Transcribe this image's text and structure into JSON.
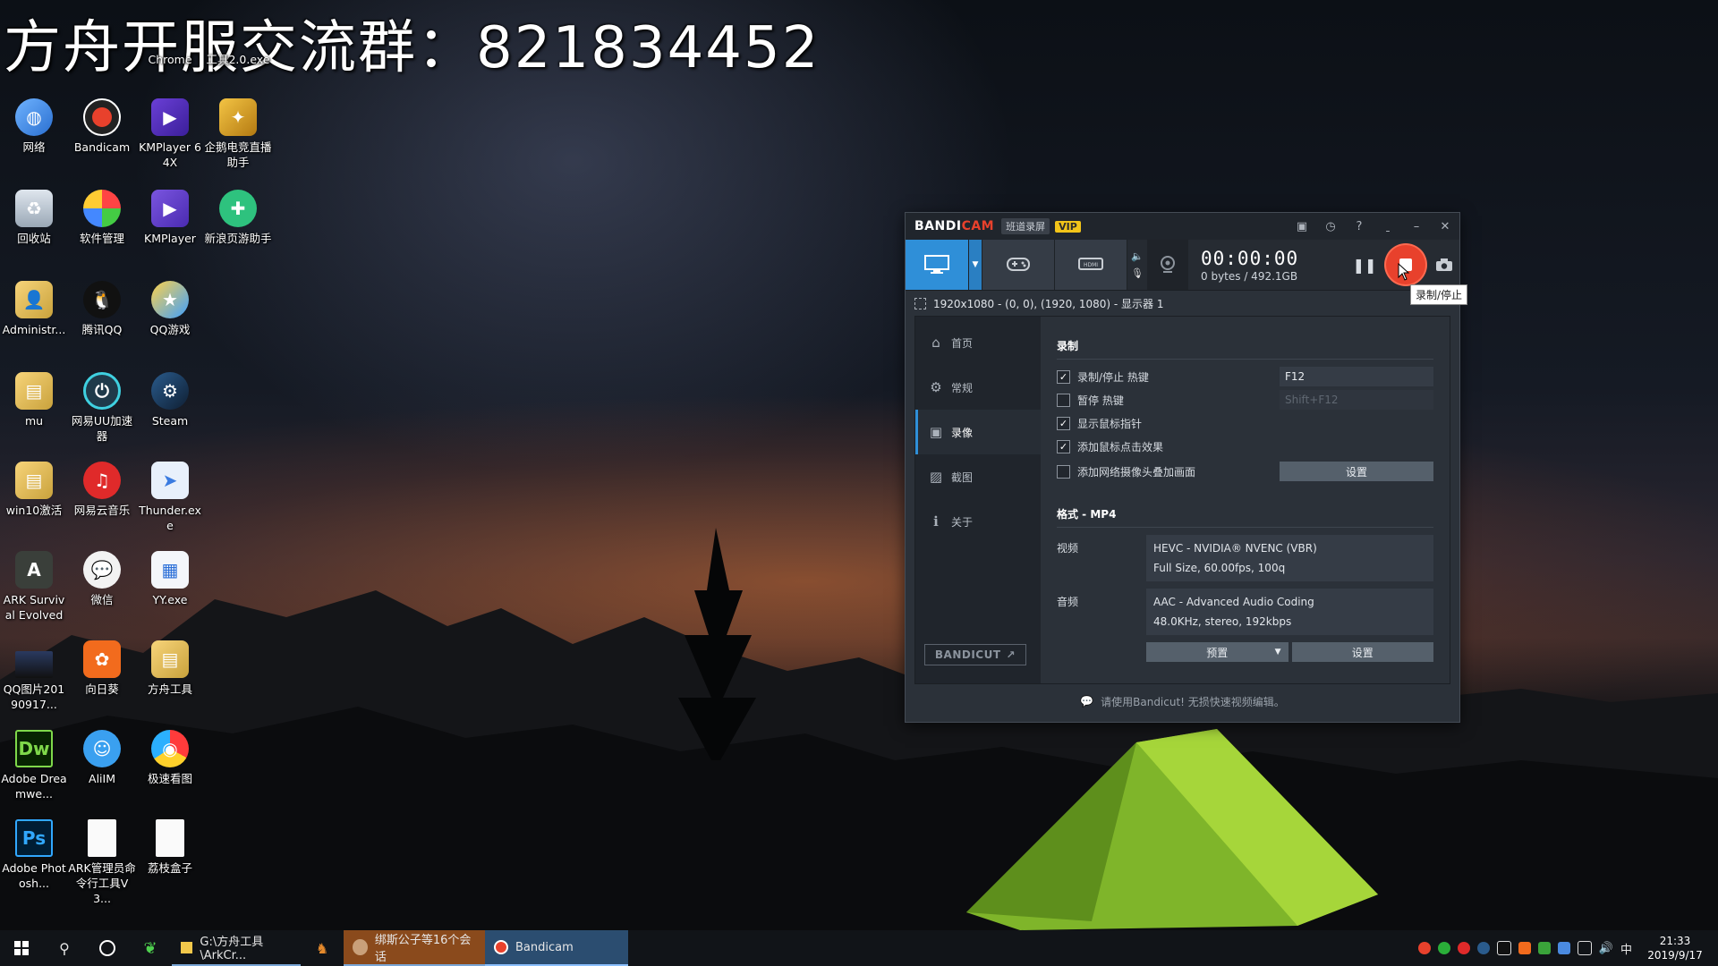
{
  "overlay": {
    "title": "方舟开服交流群：821834452"
  },
  "desktop": {
    "top_partial": [
      "Chrome",
      "工具2.0.exe"
    ],
    "icons": [
      {
        "label": "网络"
      },
      {
        "label": "Bandicam"
      },
      {
        "label": "KMPlayer 64X"
      },
      {
        "label": "企鹅电竞直播助手"
      },
      {
        "label": "回收站"
      },
      {
        "label": "软件管理"
      },
      {
        "label": "KMPlayer"
      },
      {
        "label": "新浪页游助手"
      },
      {
        "label": "Administr..."
      },
      {
        "label": "腾讯QQ"
      },
      {
        "label": "QQ游戏"
      },
      {
        "label": "mu"
      },
      {
        "label": "网易UU加速器"
      },
      {
        "label": "Steam"
      },
      {
        "label": "win10激活"
      },
      {
        "label": "网易云音乐"
      },
      {
        "label": "Thunder.exe"
      },
      {
        "label": "ARK Survival Evolved"
      },
      {
        "label": "微信"
      },
      {
        "label": "YY.exe"
      },
      {
        "label": "QQ图片20190917..."
      },
      {
        "label": "向日葵"
      },
      {
        "label": "方舟工具"
      },
      {
        "label": "Adobe Dreamwe..."
      },
      {
        "label": "AliIM"
      },
      {
        "label": "极速看图"
      },
      {
        "label": "Adobe Photosh..."
      },
      {
        "label": "ARK管理员命令行工具V3..."
      },
      {
        "label": "荔枝盒子"
      }
    ]
  },
  "bandicam": {
    "logo_a": "BANDI",
    "logo_b": "CAM",
    "tag": "班道录屏",
    "vip": "VIP",
    "timer": "00:00:00",
    "size": "0 bytes / 492.1GB",
    "tooltip": "录制/停止",
    "target": "1920x1080 - (0, 0), (1920, 1080) - 显示器 1",
    "sidebar": [
      {
        "label": "首页",
        "icon": "home-icon"
      },
      {
        "label": "常规",
        "icon": "gear-icon"
      },
      {
        "label": "录像",
        "icon": "video-icon"
      },
      {
        "label": "截图",
        "icon": "image-icon"
      },
      {
        "label": "关于",
        "icon": "info-icon"
      }
    ],
    "bandicut_label": "BANDICUT",
    "record_section": "录制",
    "options": [
      {
        "label": "录制/停止 热键",
        "checked": true,
        "value": "F12"
      },
      {
        "label": "暂停 热键",
        "checked": false,
        "value": "Shift+F12"
      },
      {
        "label": "显示鼠标指针",
        "checked": true
      },
      {
        "label": "添加鼠标点击效果",
        "checked": true
      },
      {
        "label": "添加网络摄像头叠加画面",
        "checked": false,
        "button": "设置"
      }
    ],
    "format_section": "格式 - MP4",
    "video_label": "视频",
    "video_line1": "HEVC - NVIDIA® NVENC (VBR)",
    "video_line2": "Full Size, 60.00fps, 100q",
    "audio_label": "音频",
    "audio_line1": "AAC - Advanced Audio Coding",
    "audio_line2": "48.0KHz, stereo, 192kbps",
    "preset_button": "预置",
    "settings_button": "设置",
    "footer": "请使用Bandicut! 无损快速视频编辑。"
  },
  "taskbar": {
    "apps": [
      {
        "label": "G:\\方舟工具\\ArkCr..."
      },
      {
        "label": "绑斯公子等16个会话"
      },
      {
        "label": "Bandicam"
      }
    ],
    "ime": "中",
    "time": "21:33",
    "date": "2019/9/17"
  },
  "colors": {
    "accent": "#2f8fd8",
    "record": "#e8412c",
    "vip": "#f2c419"
  }
}
